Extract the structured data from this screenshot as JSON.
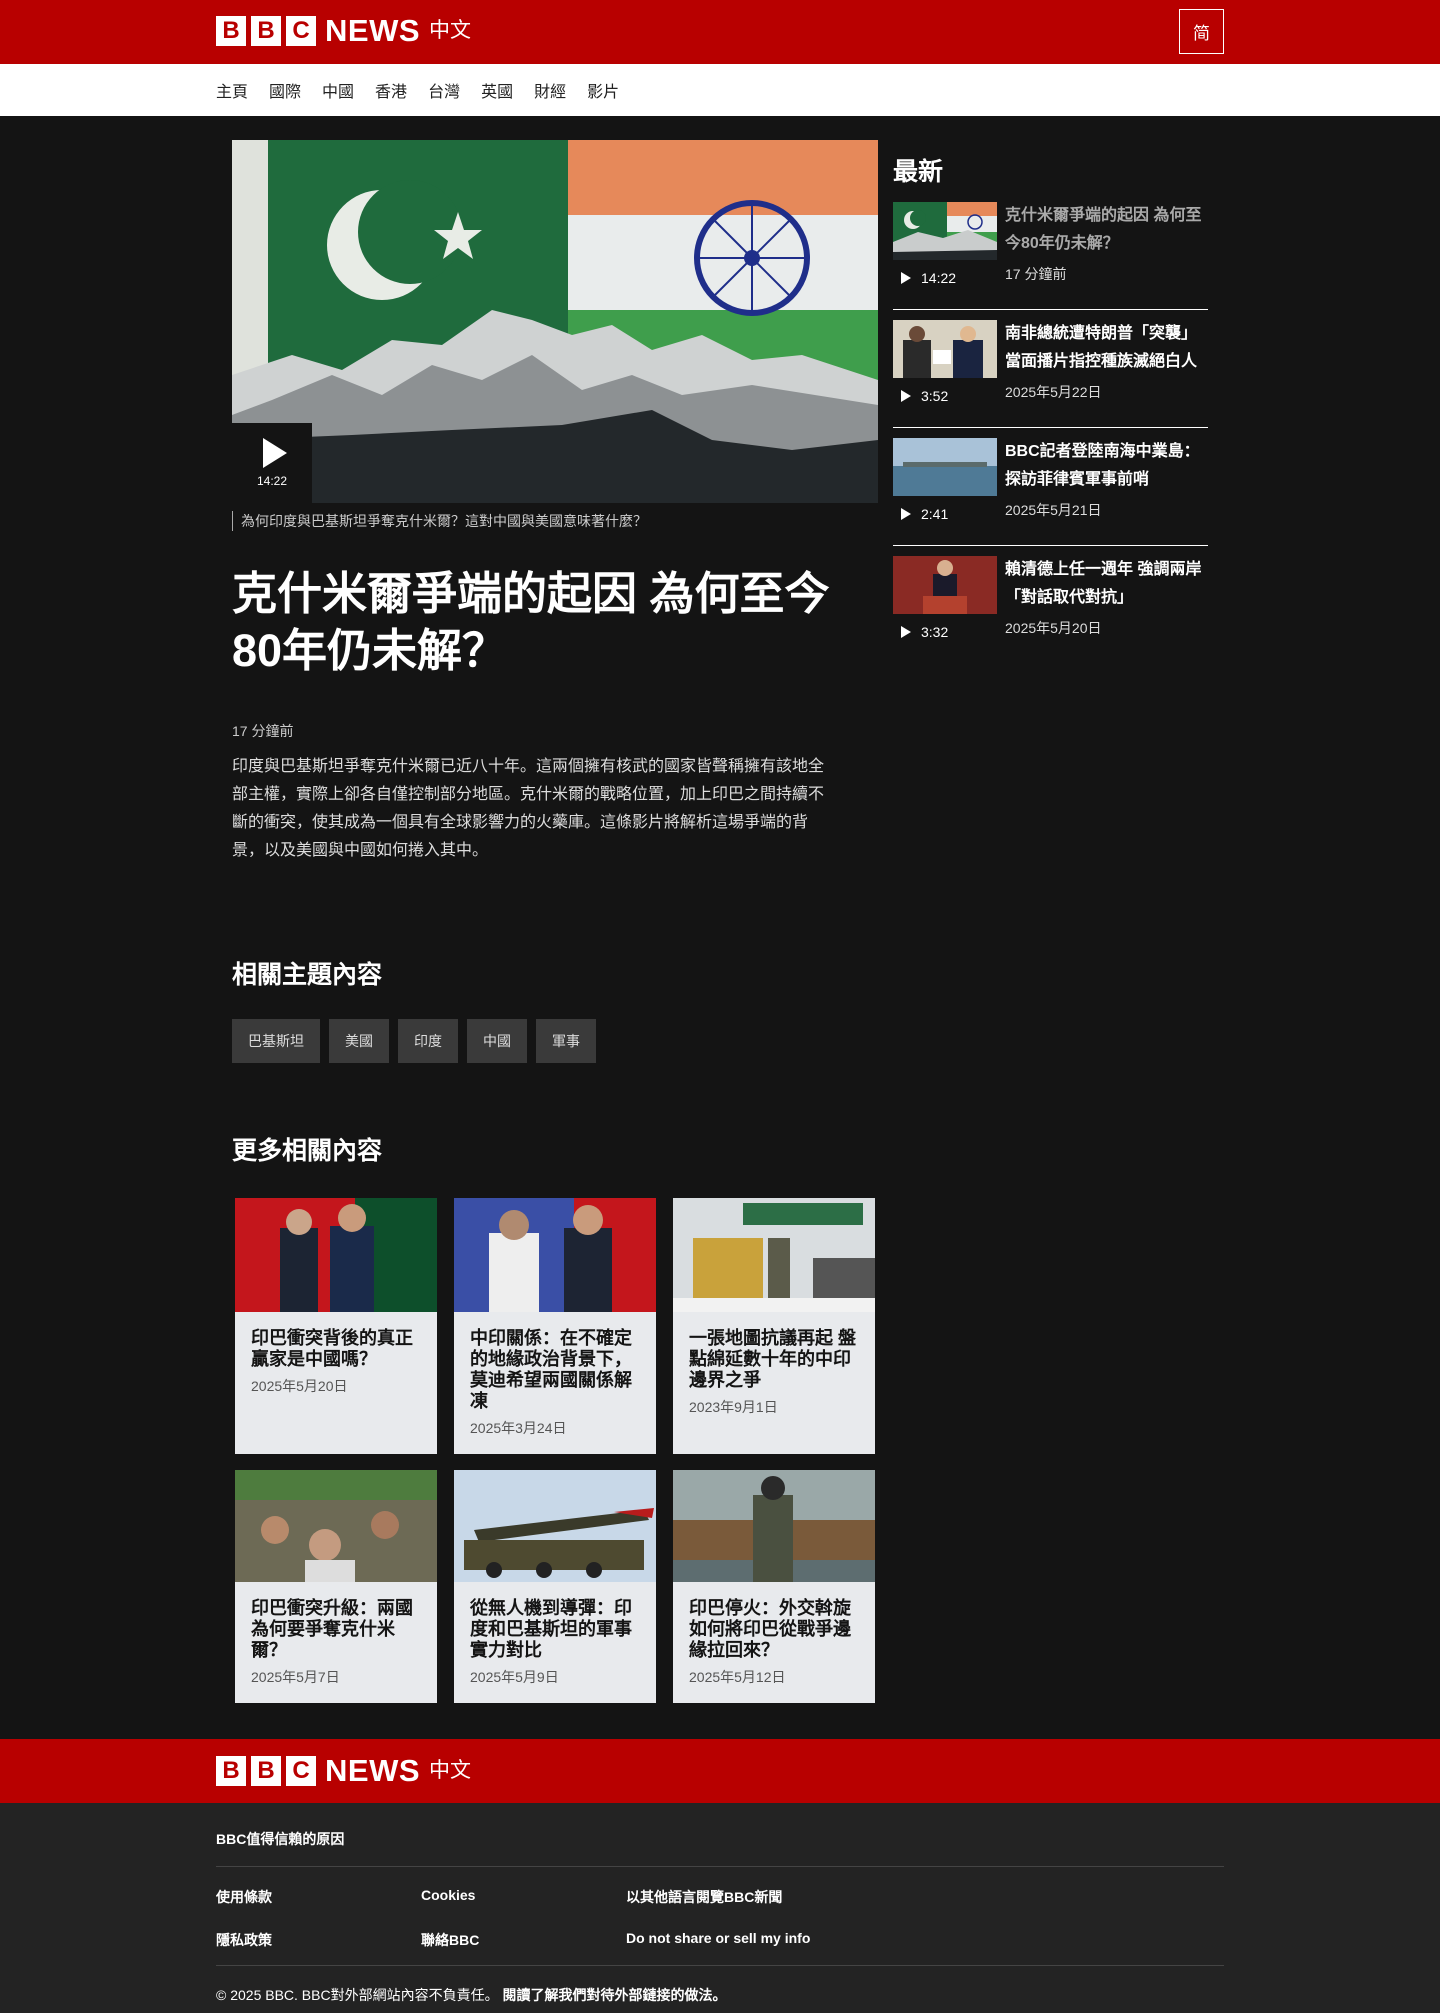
{
  "header": {
    "bbc_letters": [
      "B",
      "B",
      "C"
    ],
    "news": "NEWS",
    "lang": "中文",
    "lang_toggle": "简"
  },
  "nav": [
    "主頁",
    "國際",
    "中國",
    "香港",
    "台灣",
    "英國",
    "財經",
    "影片"
  ],
  "main": {
    "video_duration": "14:22",
    "caption": "為何印度與巴基斯坦爭奪克什米爾？這對中國與美國意味著什麼？",
    "headline": "克什米爾爭端的起因 為何至今80年仍未解？",
    "time_ago": "17 分鐘前",
    "summary": "印度與巴基斯坦爭奪克什米爾已近八十年。這兩個擁有核武的國家皆聲稱擁有該地全部主權，實際上卻各自僅控制部分地區。克什米爾的戰略位置，加上印巴之間持續不斷的衝突，使其成為一個具有全球影響力的火藥庫。這條影片將解析這場爭端的背景，以及美國與中國如何捲入其中。"
  },
  "topics": {
    "title": "相關主題內容",
    "tags": [
      "巴基斯坦",
      "美國",
      "印度",
      "中國",
      "軍事"
    ]
  },
  "more": {
    "title": "更多相關內容",
    "cards": [
      {
        "title": "印巴衝突背後的真正贏家是中國嗎？",
        "date": "2025年5月20日"
      },
      {
        "title": "中印關係：在不確定的地緣政治背景下，莫迪希望兩國關係解凍",
        "date": "2025年3月24日"
      },
      {
        "title": "一張地圖抗議再起 盤點綿延數十年的中印邊界之爭",
        "date": "2023年9月1日"
      },
      {
        "title": "印巴衝突升級：兩國為何要爭奪克什米爾？",
        "date": "2025年5月7日"
      },
      {
        "title": "從無人機到導彈：印度和巴基斯坦的軍事實力對比",
        "date": "2025年5月9日"
      },
      {
        "title": "印巴停火：外交斡旋如何將印巴從戰爭邊緣拉回來？",
        "date": "2025年5月12日"
      }
    ]
  },
  "sidebar": {
    "title": "最新",
    "items": [
      {
        "title": "克什米爾爭端的起因 為何至今80年仍未解？",
        "duration": "14:22",
        "date": "17 分鐘前"
      },
      {
        "title": "南非總統遭特朗普「突襲」 當面播片指控種族滅絕白人",
        "duration": "3:52",
        "date": "2025年5月22日"
      },
      {
        "title": "BBC記者登陸南海中業島：探訪菲律賓軍事前哨",
        "duration": "2:41",
        "date": "2025年5月21日"
      },
      {
        "title": "賴清德上任一週年 強調兩岸「對話取代對抗」",
        "duration": "3:32",
        "date": "2025年5月20日"
      }
    ]
  },
  "footer": {
    "trust": "BBC值得信賴的原因",
    "links": [
      "使用條款",
      "Cookies",
      "以其他語言閱覽BBC新聞",
      "隱私政策",
      "聯絡BBC",
      "Do not share or sell my info"
    ],
    "copyright": "© 2025 BBC. BBC對外部網站內容不負責任。",
    "external_link": "閱讀了解我們對待外部鏈接的做法。"
  },
  "colors": {
    "brand_red": "#b80000",
    "page_bg": "#141414",
    "card_bg": "#e8eaed"
  }
}
